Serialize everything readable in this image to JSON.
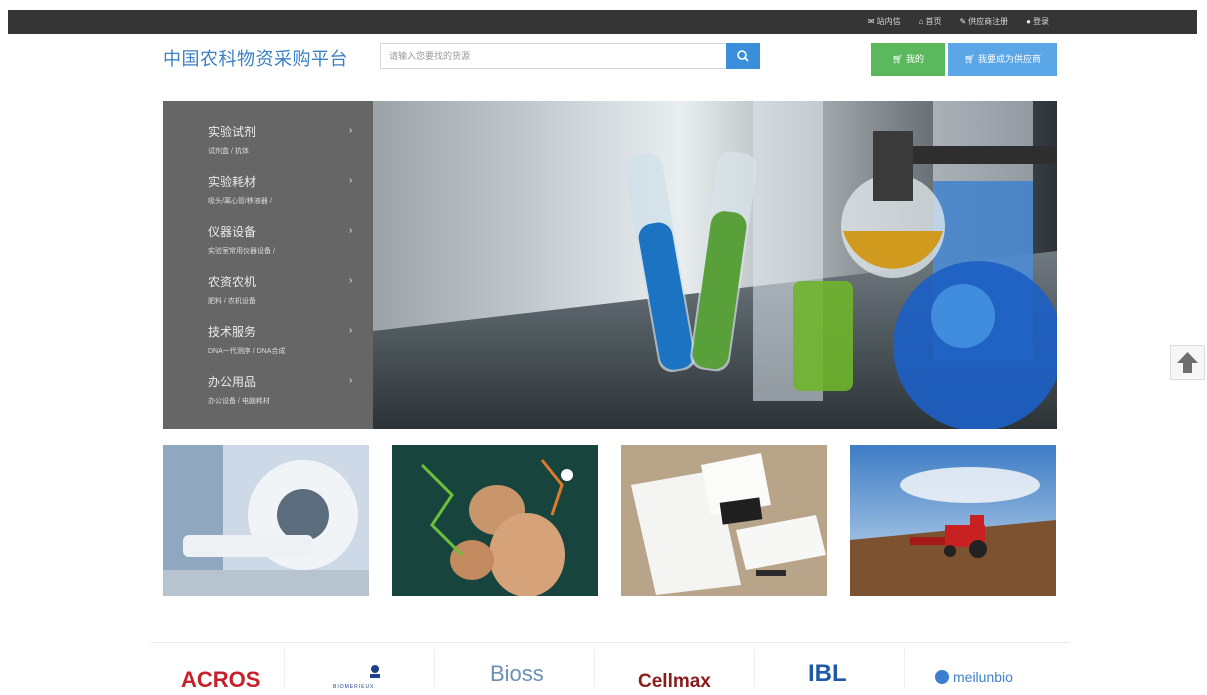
{
  "topbar": {
    "links": [
      {
        "label": "站内信",
        "icon": "mail-icon"
      },
      {
        "label": "首页",
        "icon": "home-icon"
      },
      {
        "label": "供应商注册",
        "icon": "edit-icon"
      },
      {
        "label": "登录",
        "icon": "user-icon"
      }
    ]
  },
  "header": {
    "logo_text": "中国农科物资采购平台",
    "search": {
      "placeholder": "请输入您要找的货源",
      "icon": "search-icon"
    },
    "buttons": {
      "cart_label": "我的",
      "cart_icon": "cart-icon",
      "supplier_label": "我要成为供应商",
      "supplier_icon": "cart-icon"
    }
  },
  "menu": {
    "items": [
      {
        "title": "实验试剂",
        "sub": "试剂盒 / 抗体"
      },
      {
        "title": "实验耗材",
        "sub": "吸头/离心管/移液器 /"
      },
      {
        "title": "仪器设备",
        "sub": "实验室常用仪器设备 /"
      },
      {
        "title": "农资农机",
        "sub": "肥料 / 农机设备"
      },
      {
        "title": "技术服务",
        "sub": "DNA一代测序 / DNA合成"
      },
      {
        "title": "办公用品",
        "sub": "办公设备 / 电脑耗材"
      }
    ],
    "arrow": "›"
  },
  "banner": {
    "alt": "chemistry-glassware-banner"
  },
  "thumbs": [
    {
      "name": "mri-scanner-image"
    },
    {
      "name": "molecules-image"
    },
    {
      "name": "stationery-image"
    },
    {
      "name": "tractor-field-image"
    }
  ],
  "brands": [
    {
      "name": "ACROS"
    },
    {
      "name": "BIOMERIEUX"
    },
    {
      "name": "Bioss"
    },
    {
      "name": "Cellmax"
    },
    {
      "name": "IBL"
    },
    {
      "name": "meilunbio"
    }
  ],
  "colors": {
    "topbar": "#353535",
    "logo": "#3b7fc4",
    "search_button": "#3b8ed9",
    "green_button": "#5cb85c",
    "blue_button": "#5aa6e6",
    "menu_bg": "#666666"
  },
  "back_to_top": {
    "icon": "arrow-up-icon"
  }
}
